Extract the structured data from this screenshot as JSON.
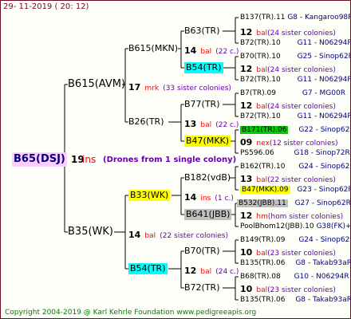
{
  "header": {
    "date": "29- 11-2019 ( 20: 12)"
  },
  "footer": {
    "copyright": "Copyright 2004-2019 @ Karl Kehrle Foundation    www.pedigreeapis.org"
  },
  "root": {
    "name": "B65(DSJ)",
    "count": "19",
    "label": "ins",
    "note": "(Drones from 1 single colony)"
  },
  "gen1": [
    {
      "name": "B615(AVM)",
      "count": "17",
      "label": "mrk",
      "sisters": "(33 sister colonies)"
    },
    {
      "name": "B35(WK)",
      "count": "14",
      "label": "bal",
      "sisters": "(22 sister colonies)"
    }
  ],
  "gen2": [
    {
      "name": "B615(MKN)",
      "count": "14",
      "label": "bal",
      "sisters": "(22 c.)"
    },
    {
      "name": "B26(TR)",
      "count": "13",
      "label": "bal",
      "sisters": "(22 c.)"
    },
    {
      "name": "B33(WK)",
      "count": "14",
      "label": "ins",
      "sisters": "(1 c.)"
    },
    {
      "name": "B54(TR)",
      "count": "12",
      "label": "bal",
      "sisters": "(24 c.)"
    }
  ],
  "gen3": [
    {
      "name": "B63(TR)",
      "count": "12",
      "label": "bal",
      "sisters": "(24 sister colonies)"
    },
    {
      "name": "B54(TR)",
      "count": "12",
      "label": "bal",
      "sisters": "(24 sister colonies)"
    },
    {
      "name": "B77(TR)",
      "count": "12",
      "label": "bal",
      "sisters": "(24 sister colonies)"
    },
    {
      "name": "B47(MKK)",
      "count": "09",
      "label": "nex",
      "sisters": "(12 sister colonies)"
    },
    {
      "name": "B182(vdB)",
      "count": "13",
      "label": "bal",
      "sisters": "(22 sister colonies)"
    },
    {
      "name": "B641(JBB)",
      "count": "12",
      "label": "hm",
      "sisters": "(hom sister colonies)"
    },
    {
      "name": "B70(TR)",
      "count": "10",
      "label": "bal",
      "sisters": "(23 sister colonies)"
    },
    {
      "name": "B72(TR)",
      "count": "10",
      "label": "bal",
      "sisters": "(23 sister colonies)"
    }
  ],
  "leaves": [
    {
      "name": "B137(TR).11",
      "right": "G8 - Kangaroo98R"
    },
    {
      "name": "B72(TR).10",
      "right": "G11 - N06294R"
    },
    {
      "name": "B70(TR).10",
      "right": "G25 - Sinop62R"
    },
    {
      "name": "B72(TR).10",
      "right": "G11 - N06294R"
    },
    {
      "name": "B7(TR).09",
      "right": "G7 - MG00R"
    },
    {
      "name": "B72(TR).10",
      "right": "G11 - N06294R"
    },
    {
      "name": "B171(TR).06",
      "right": "G22 - Sinop62R"
    },
    {
      "name": "PS596.06",
      "right": "G18 - Sinop72R"
    },
    {
      "name": "B162(TR).10",
      "right": "G24 - Sinop62R"
    },
    {
      "name": "B47(MKK).09",
      "right": "G23 - Sinop62R"
    },
    {
      "name": "B532(JBB).11",
      "right": "G27 - Sinop62R"
    },
    {
      "name": "PoolBhom12(JBB).10",
      "right": "G38(FK)+3"
    },
    {
      "name": "B149(TR).09",
      "right": "G24 - Sinop62R"
    },
    {
      "name": "B135(TR).06",
      "right": "G8 - Takab93aR"
    },
    {
      "name": "B68(TR).08",
      "right": "G10 - N06294R"
    },
    {
      "name": "B135(TR).06",
      "right": "G8 - Takab93aR"
    }
  ]
}
